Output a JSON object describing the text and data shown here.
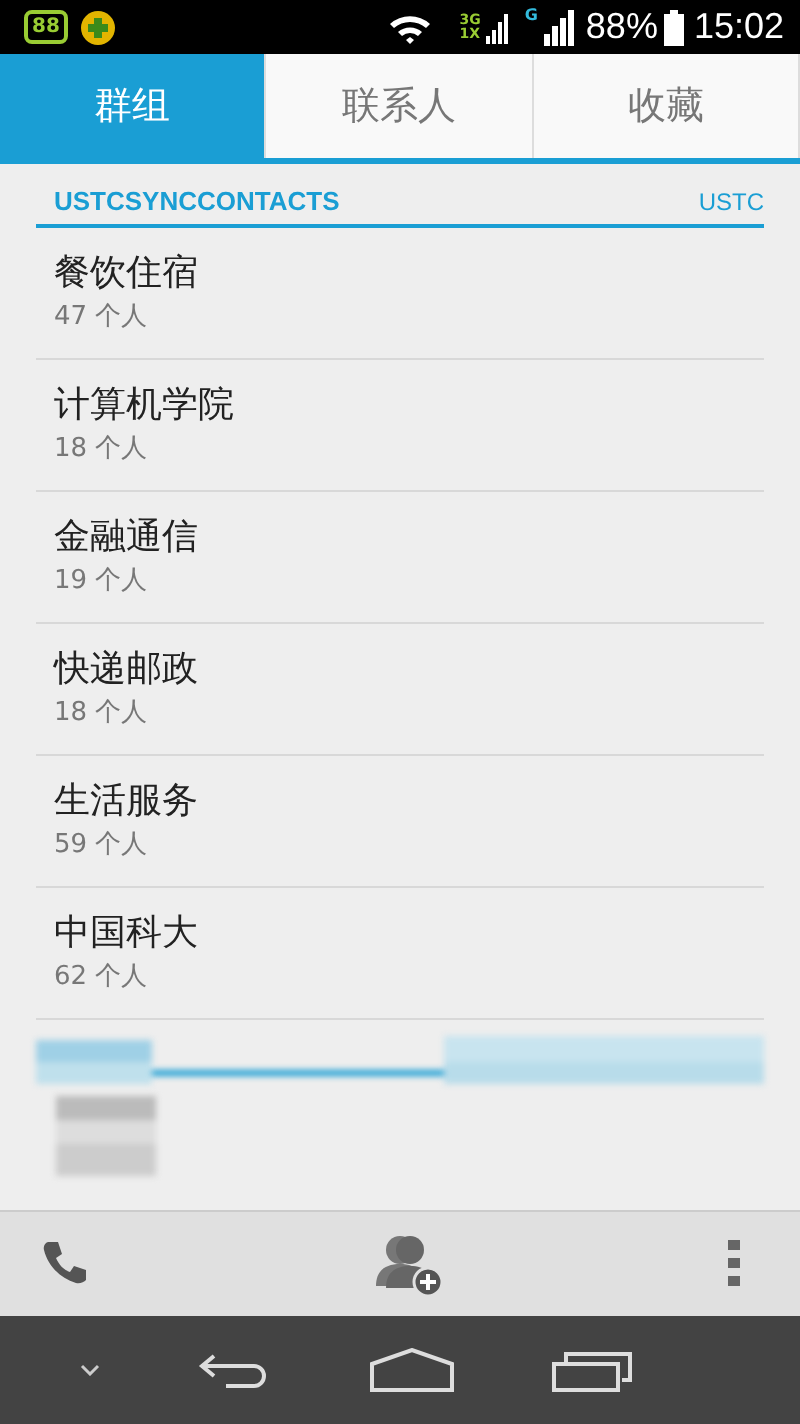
{
  "status_bar": {
    "badge": "88",
    "network_top": "3G",
    "network_bottom": "1X",
    "network_single": "G",
    "battery": "88%",
    "time": "15:02"
  },
  "tabs": [
    {
      "label": "群组",
      "selected": true
    },
    {
      "label": "联系人",
      "selected": false
    },
    {
      "label": "收藏",
      "selected": false
    }
  ],
  "section": {
    "title": "USTCSYNCCONTACTS",
    "account": "USTC"
  },
  "groups": [
    {
      "name": "餐饮住宿",
      "count": "47 个人"
    },
    {
      "name": "计算机学院",
      "count": "18 个人"
    },
    {
      "name": "金融通信",
      "count": "19 个人"
    },
    {
      "name": "快递邮政",
      "count": "18 个人"
    },
    {
      "name": "生活服务",
      "count": "59 个人"
    },
    {
      "name": "中国科大",
      "count": "62 个人"
    }
  ]
}
